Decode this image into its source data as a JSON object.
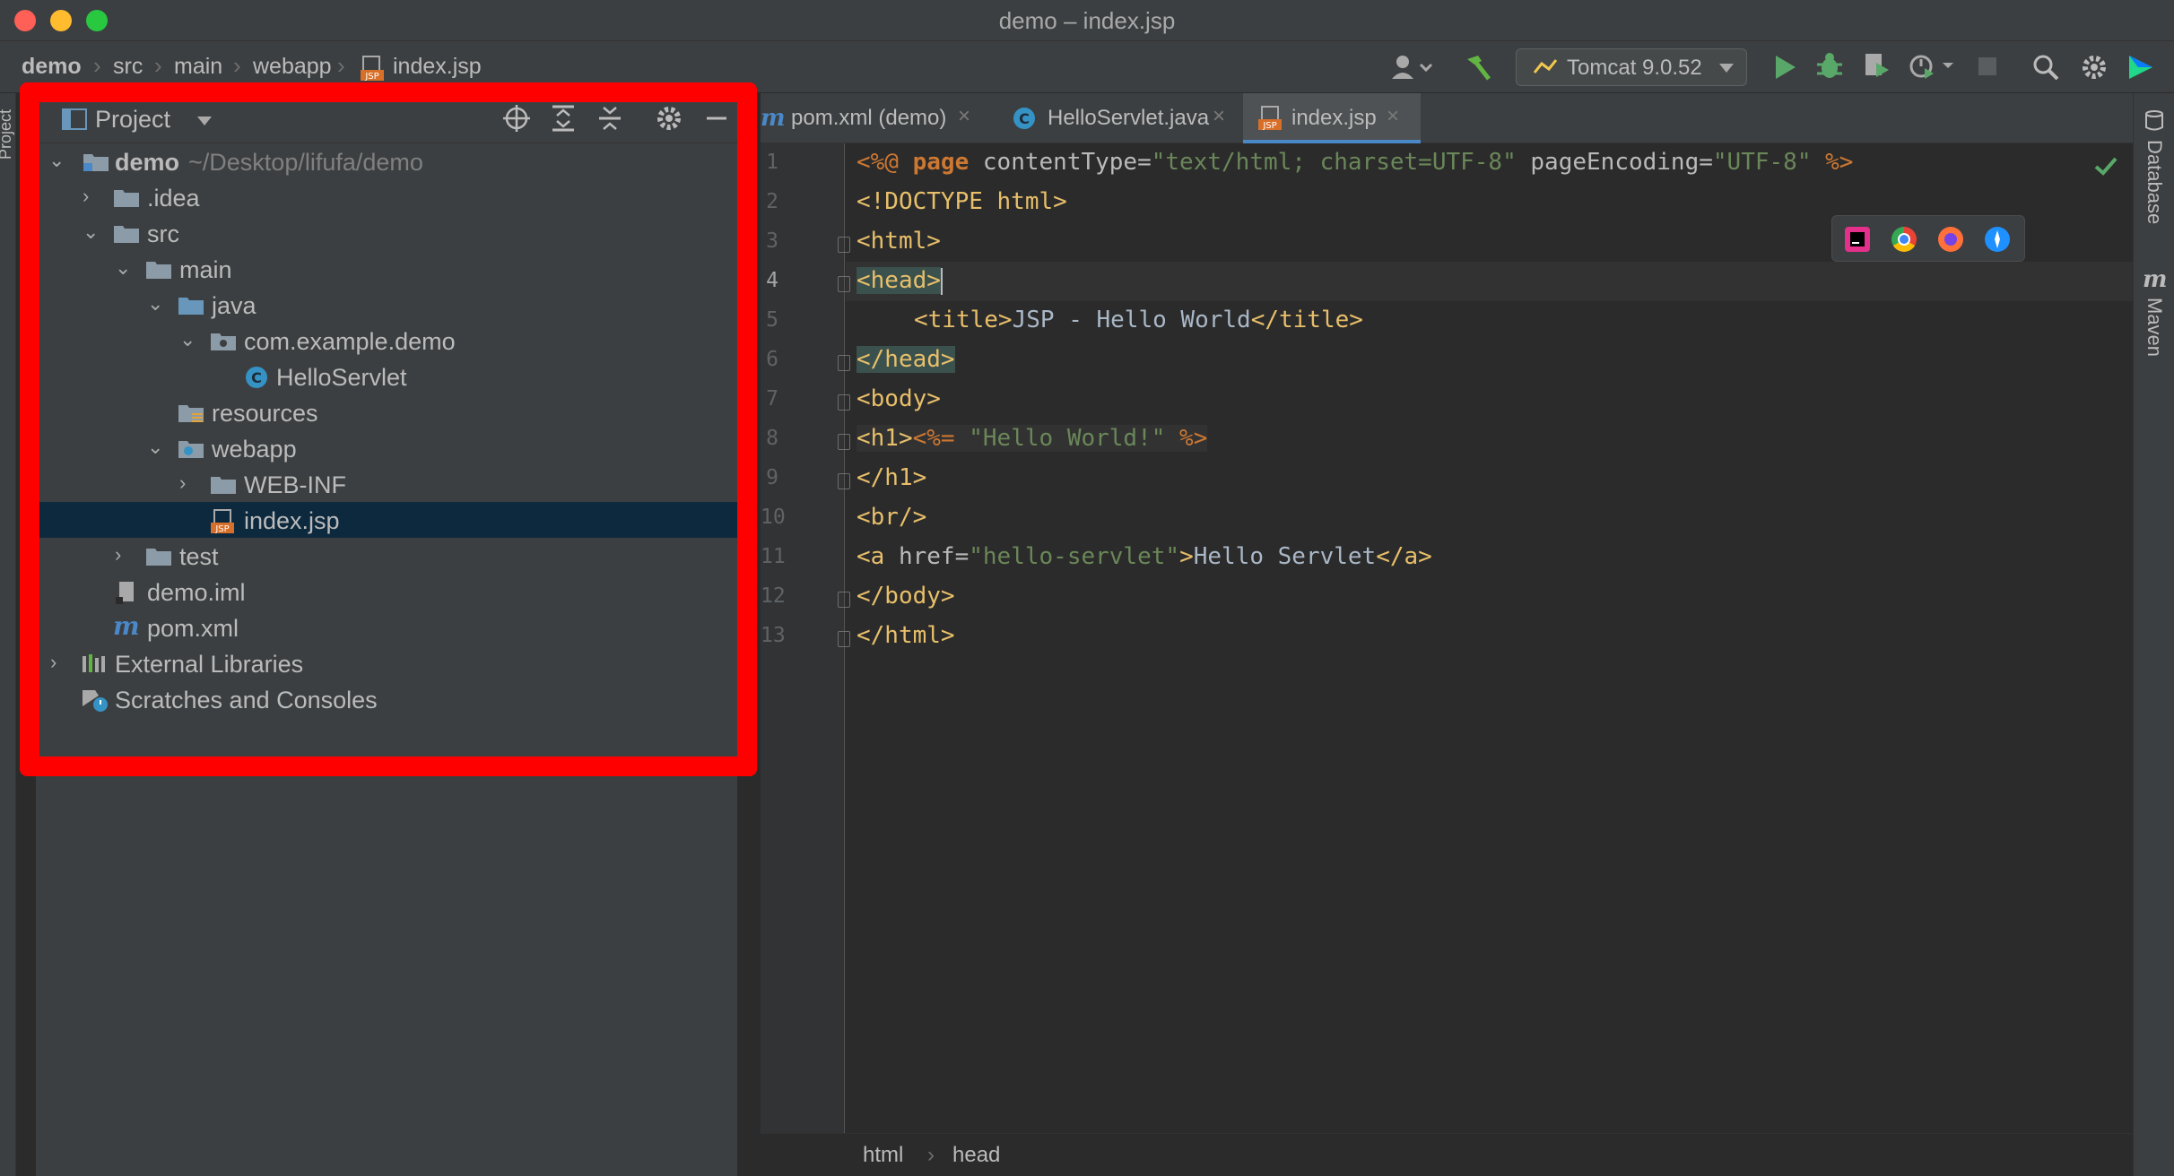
{
  "window": {
    "title": "demo – index.jsp"
  },
  "navbar": {
    "breadcrumbs": [
      "demo",
      "src",
      "main",
      "webapp",
      "index.jsp"
    ],
    "run_config": "Tomcat 9.0.52"
  },
  "project_panel": {
    "title": "Project",
    "tree": [
      {
        "label": "demo",
        "hint": "~/Desktop/lifufa/demo",
        "icon": "module-folder-icon",
        "expanded": true
      },
      {
        "label": ".idea",
        "icon": "folder-icon",
        "expanded": false
      },
      {
        "label": "src",
        "icon": "folder-icon",
        "expanded": true
      },
      {
        "label": "main",
        "icon": "folder-icon",
        "expanded": true
      },
      {
        "label": "java",
        "icon": "source-folder-icon",
        "expanded": true
      },
      {
        "label": "com.example.demo",
        "icon": "package-icon",
        "expanded": true
      },
      {
        "label": "HelloServlet",
        "icon": "class-icon"
      },
      {
        "label": "resources",
        "icon": "resources-folder-icon"
      },
      {
        "label": "webapp",
        "icon": "web-folder-icon",
        "expanded": true
      },
      {
        "label": "WEB-INF",
        "icon": "folder-icon",
        "expanded": false
      },
      {
        "label": "index.jsp",
        "icon": "jsp-file-icon",
        "selected": true
      },
      {
        "label": "test",
        "icon": "folder-icon",
        "expanded": false
      },
      {
        "label": "demo.iml",
        "icon": "iml-file-icon"
      },
      {
        "label": "pom.xml",
        "icon": "maven-icon"
      },
      {
        "label": "External Libraries",
        "icon": "libraries-icon",
        "expanded": false
      },
      {
        "label": "Scratches and Consoles",
        "icon": "scratches-icon"
      }
    ]
  },
  "editor": {
    "tabs": [
      {
        "label": "pom.xml (demo)",
        "icon": "maven-icon"
      },
      {
        "label": "HelloServlet.java",
        "icon": "class-icon"
      },
      {
        "label": "index.jsp",
        "icon": "jsp-file-icon",
        "active": true
      }
    ],
    "line_numbers": [
      "1",
      "2",
      "3",
      "4",
      "5",
      "6",
      "7",
      "8",
      "9",
      "10",
      "11",
      "12",
      "13"
    ],
    "code": {
      "l1_a": "<%@ ",
      "l1_b": "page",
      "l1_c": " contentType=",
      "l1_d": "\"text/html; charset=UTF-8\"",
      "l1_e": " pageEncoding=",
      "l1_f": "\"UTF-8\"",
      "l1_g": " %>",
      "l2": "<!DOCTYPE html>",
      "l3": "<html>",
      "l4": "<head>",
      "l5_a": "<title>",
      "l5_b": "JSP - Hello World",
      "l5_c": "</title>",
      "l6": "</head>",
      "l7": "<body>",
      "l8_a": "<h1>",
      "l8_b": "<%= ",
      "l8_c": "\"Hello World!\"",
      "l8_d": " %>",
      "l9": "</h1>",
      "l10": "<br/>",
      "l11_a": "<a ",
      "l11_b": "href=",
      "l11_c": "\"hello-servlet\"",
      "l11_d": ">",
      "l11_e": "Hello Servlet",
      "l11_f": "</a>",
      "l12": "</body>",
      "l13": "</html>"
    },
    "status_crumbs": [
      "html",
      "head"
    ]
  },
  "right_strip": {
    "database": "Database",
    "maven": "Maven"
  },
  "left_strip": {
    "project": "Project"
  },
  "colors": {
    "highlight": "#ff0000",
    "selection": "#0d293e",
    "accent": "#4a88c7"
  }
}
